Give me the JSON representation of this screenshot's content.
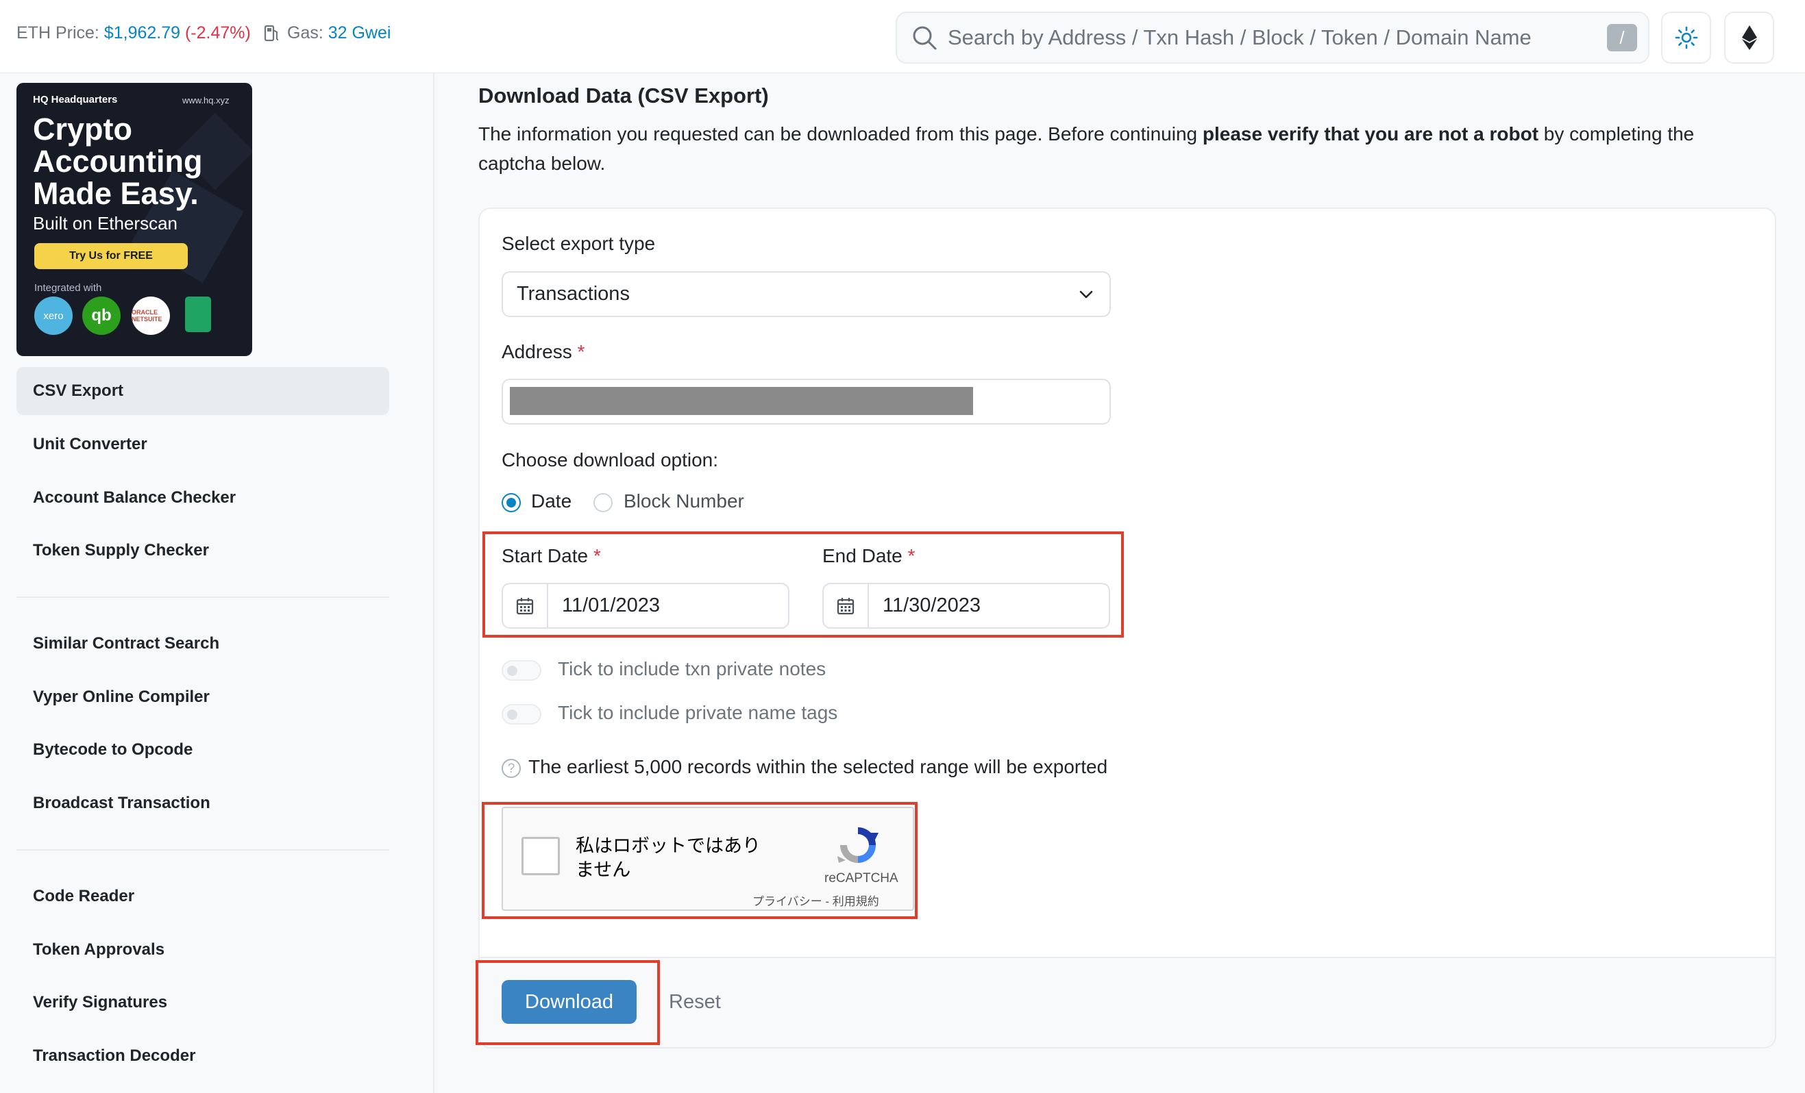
{
  "header": {
    "eth_price_label": "ETH Price:",
    "eth_price_value": "$1,962.79",
    "eth_price_change": "(-2.47%)",
    "gas_label": "Gas:",
    "gas_value": "32 Gwei",
    "search_placeholder": "Search by Address / Txn Hash / Block / Token / Domain Name",
    "search_shortcut": "/"
  },
  "ad": {
    "logo": "HQ Headquarters",
    "url": "www.hq.xyz",
    "headline": "Crypto Accounting Made Easy.",
    "subline": "Built on Etherscan",
    "cta": "Try Us for FREE",
    "integrated": "Integrated with",
    "apps": {
      "xero": "xero",
      "qb": "qb",
      "oracle": "ORACLE NETSUITE"
    }
  },
  "sidebar": {
    "group1": [
      "CSV Export",
      "Unit Converter",
      "Account Balance Checker",
      "Token Supply Checker"
    ],
    "group2": [
      "Similar Contract Search",
      "Vyper Online Compiler",
      "Bytecode to Opcode",
      "Broadcast Transaction"
    ],
    "group3": [
      "Code Reader",
      "Token Approvals",
      "Verify Signatures",
      "Transaction Decoder"
    ]
  },
  "main": {
    "title": "Download Data (CSV Export)",
    "intro_pre": "The information you requested can be downloaded from this page. Before continuing ",
    "intro_bold": "please verify that you are not a robot",
    "intro_post": " by completing the captcha below."
  },
  "form": {
    "export_type_label": "Select export type",
    "export_type_value": "Transactions",
    "address_label": "Address",
    "required_mark": "*",
    "download_option_label": "Choose download option:",
    "option_date": "Date",
    "option_block": "Block Number",
    "start_date_label": "Start Date",
    "start_date_value": "11/01/2023",
    "end_date_label": "End Date",
    "end_date_value": "11/30/2023",
    "toggle_notes": "Tick to include txn private notes",
    "toggle_tags": "Tick to include private name tags",
    "records_note": "The earliest 5,000 records within the selected range will be exported",
    "download_label": "Download",
    "reset_label": "Reset"
  },
  "captcha": {
    "label": "私はロボットではありません",
    "brand": "reCAPTCHA",
    "links": "プライバシー - 利用規約"
  },
  "colors": {
    "accent": "#0784c3",
    "negative": "#dc3545",
    "highlight_box": "#e03e2d",
    "button": "#3a84c4"
  }
}
